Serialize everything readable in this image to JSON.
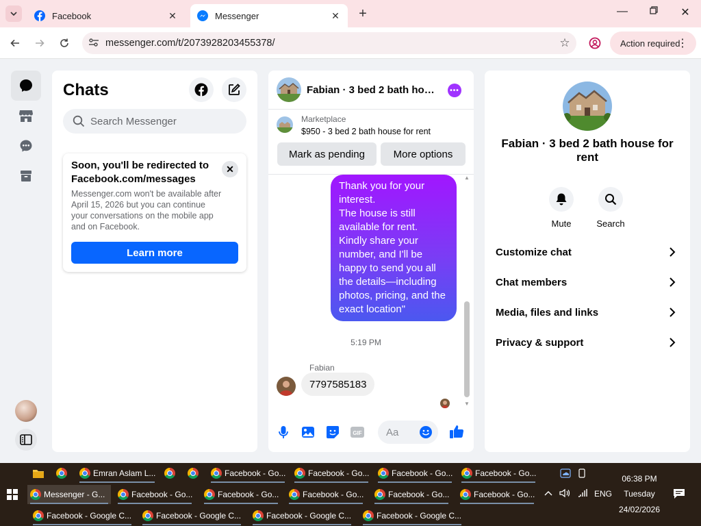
{
  "browser": {
    "tabs": [
      {
        "title": "Facebook",
        "active": false
      },
      {
        "title": "Messenger",
        "active": true
      }
    ],
    "url": "messenger.com/t/2073928203455378/",
    "action_required": "Action required"
  },
  "chats_panel": {
    "title": "Chats",
    "search_placeholder": "Search Messenger",
    "notice": {
      "title": "Soon, you'll be redirected to Facebook.com/messages",
      "body": "Messenger.com won't be available after April 15, 2026 but you can continue your conversations on the mobile app and on Facebook.",
      "button": "Learn more"
    }
  },
  "conversation": {
    "title": "Fabian · 3 bed 2 bath house for rent",
    "marketplace_label": "Marketplace",
    "listing": "$950 - 3 bed 2 bath house for rent",
    "mark_pending": "Mark as pending",
    "more_options": "More options",
    "outgoing_message": "Thank you for your interest.\nThe house is still available for rent. Kindly share your number, and I'll be happy to send you all the details—including photos, pricing, and the exact location\"",
    "timestamp": "5:19 PM",
    "sender": "Fabian",
    "incoming_message": "7797585183",
    "input_placeholder": "Aa"
  },
  "info_panel": {
    "name": "Fabian · 3 bed 2 bath house for rent",
    "actions": [
      "Mute",
      "Search"
    ],
    "rows": [
      "Customize chat",
      "Chat members",
      "Media, files and links",
      "Privacy & support"
    ]
  },
  "taskbar": {
    "row1": [
      "Emran Aslam L...",
      "Facebook - Go...",
      "Facebook - Go...",
      "Facebook - Go...",
      "Facebook - Go..."
    ],
    "row2": [
      "Messenger - G...",
      "Facebook - Go...",
      "Facebook - Go...",
      "Facebook - Go...",
      "Facebook - Go...",
      "Facebook - Go..."
    ],
    "row3": [
      "Facebook - Google C...",
      "Facebook - Google C...",
      "Facebook - Google C...",
      "Facebook - Google C..."
    ],
    "language": "ENG",
    "time": "06:38 PM",
    "day": "Tuesday",
    "date": "24/02/2026"
  },
  "colors": {
    "brand_blue": "#0866ff",
    "bubble_purple": "#a116ff",
    "tab_bar": "#fbe3e6",
    "taskbar": "#2a1f16"
  }
}
